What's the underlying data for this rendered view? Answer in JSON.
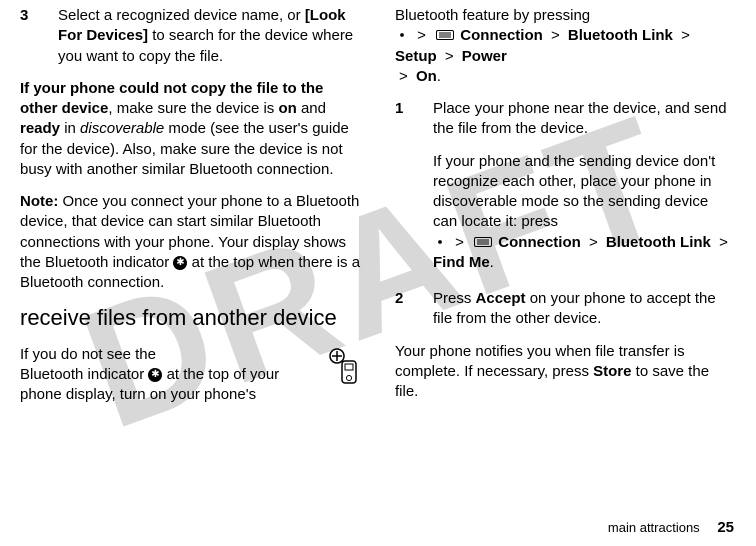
{
  "watermark": "DRAFT",
  "left": {
    "step3": {
      "num": "3",
      "text_a": "Select a recognized device name, or ",
      "look": "[Look For Devices]",
      "text_b": " to search for the device where you want to copy the file."
    },
    "cannot": {
      "lead_a": "If your phone could not copy the file to the other device",
      "lead_b": ", make sure the device is ",
      "on": "on",
      "and": " and ",
      "ready": "ready",
      "in": " in ",
      "disc": "discoverable",
      "tail": " mode (see the user's guide for the device). Also, make sure the device is not busy with another similar Bluetooth connection."
    },
    "note": {
      "label": "Note:",
      "text_a": " Once you connect your phone to a Bluetooth device, that device can start similar Bluetooth connections with your phone. Your display shows the Bluetooth indicator ",
      "text_b": " at the top when there is a Bluetooth connection."
    },
    "heading": "receive files from another device",
    "nobt": {
      "text_a": "If you do not see the",
      "text_b": "Bluetooth indicator ",
      "text_c": " at the top of your",
      "text_d": "phone display, turn on your phone's"
    }
  },
  "right": {
    "bt_feature": {
      "lead": "Bluetooth feature by pressing",
      "connection": "Connection",
      "btlink": "Bluetooth Link",
      "setup": "Setup",
      "power": "Power",
      "on": "On",
      "period": "."
    },
    "step1": {
      "num": "1",
      "text": "Place your phone near the device, and send the file from the device.",
      "text2a": "If your phone and the sending device don't recognize each other, place your phone in discoverable mode so the sending device can locate it: press",
      "connection": "Connection",
      "btlink": "Bluetooth Link",
      "findme": "Find Me",
      "period": "."
    },
    "step2": {
      "num": "2",
      "text_a": "Press ",
      "accept": "Accept",
      "text_b": " on your phone to accept the file from the other device."
    },
    "closing": {
      "text_a": "Your phone notifies you when file transfer is complete. If necessary, press ",
      "store": "Store",
      "text_b": " to save the file."
    }
  },
  "footer": {
    "section": "main attractions",
    "page": "25"
  },
  "gt": ">"
}
